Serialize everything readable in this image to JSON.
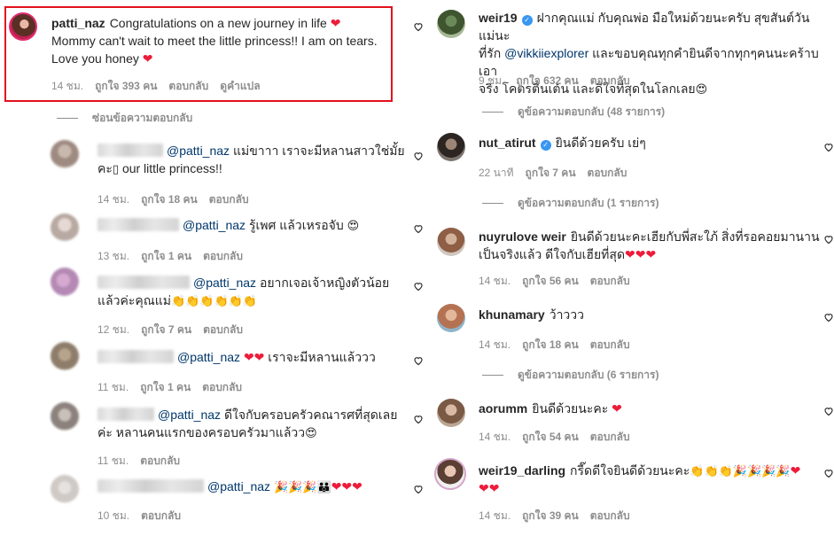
{
  "colors": {
    "highlight": "#e2111c",
    "verified": "#3897f0",
    "mention": "#00376b",
    "meta": "#8e8e8e",
    "heart": "#ed1c3a"
  },
  "icons": {
    "like": "heart-outline-icon",
    "verified": "verified-badge-icon"
  },
  "left": {
    "top_comment": {
      "username": "patti_naz",
      "text_1": "Congratulations on a new journey in life",
      "text_2": "Mommy can't wait to meet the little princess!! I am on tears.",
      "text_3": "Love you honey",
      "time": "14 ชม.",
      "likes": "ถูกใจ 393 คน",
      "reply": "ตอบกลับ",
      "translate": "ดูคำแปล"
    },
    "hide_replies": "ซ่อนข้อความตอบกลับ",
    "replies": [
      {
        "mention": "@patti_naz",
        "text_1": "แม่ขาาา เราจะมีหลานสาวใช่มั้ย",
        "text_2": "คะ",
        "text_3": "our little princess!!",
        "time": "14 ชม.",
        "likes": "ถูกใจ 18 คน",
        "reply": "ตอบกลับ"
      },
      {
        "mention": "@patti_naz",
        "text_1": "รู้เพศ แล้วเหรอจับ",
        "time": "13 ชม.",
        "likes": "ถูกใจ 1 คน",
        "reply": "ตอบกลับ"
      },
      {
        "mention": "@patti_naz",
        "text_1": "อยากเจอเจ้าหญิงตัวน้อย",
        "text_2": "แล้วค่ะคุณแม่",
        "time": "12 ชม.",
        "likes": "ถูกใจ 7 คน",
        "reply": "ตอบกลับ"
      },
      {
        "mention": "@patti_naz",
        "text_1": "เราจะมีหลานแล้ววว",
        "time": "11 ชม.",
        "likes": "ถูกใจ 1 คน",
        "reply": "ตอบกลับ"
      },
      {
        "mention": "@patti_naz",
        "text_1": "ดีใจกับครอบครัวคณารศที่สุดเลย",
        "text_2": "ค่ะ หลานคนแรกของครอบครัวมาแล้วว",
        "time": "11 ชม.",
        "reply": "ตอบกลับ"
      },
      {
        "mention": "@patti_naz",
        "time": "10 ชม.",
        "reply": "ตอบกลับ"
      }
    ]
  },
  "right": {
    "comments": [
      {
        "username": "weir19",
        "text_1": "ฝากคุณแม่ กับคุณพ่อ มือใหม่ด้วยนะครับ สุขสันต์วันแม่นะ",
        "text_2": "ที่รัก",
        "mention": "@vikkiiexplorer",
        "text_3": "และขอบคุณทุกคำยินดีจากทุกๆคนนะคร้าบ เอา",
        "text_4": "จริง โคตรตื่นเต้น และดีใจที่สุดในโลกเลย",
        "time": "9 ชม.",
        "likes": "ถูกใจ 632 คน",
        "reply": "ตอบกลับ",
        "view_replies": "ดูข้อความตอบกลับ (48 รายการ)"
      },
      {
        "username": "nut_atirut",
        "text_1": "ยินดีด้วยครับ เย่ๆ",
        "time": "22 นาที",
        "likes": "ถูกใจ 7 คน",
        "reply": "ตอบกลับ",
        "view_replies": "ดูข้อความตอบกลับ (1 รายการ)"
      },
      {
        "username": "nuyrulove weir",
        "text_1": "ยินดีด้วยนะคะเฮียกับพี่สะใภ้ สิ่งที่รอคอยมานาน",
        "text_2": "เป็นจริงแล้ว ดีใจกับเฮียที่สุด",
        "time": "14 ชม.",
        "likes": "ถูกใจ 56 คน",
        "reply": "ตอบกลับ"
      },
      {
        "username": "khunamary",
        "text_1": "ว้าววว",
        "time": "14 ชม.",
        "likes": "ถูกใจ 18 คน",
        "reply": "ตอบกลับ",
        "view_replies": "ดูข้อความตอบกลับ (6 รายการ)"
      },
      {
        "username": "aorumm",
        "text_1": "ยินดีด้วยนะคะ",
        "time": "14 ชม.",
        "likes": "ถูกใจ 54 คน",
        "reply": "ตอบกลับ"
      },
      {
        "username": "weir19_darling",
        "text_1": "กรี๊ดดีใจยินดีด้วยนะคะ",
        "time": "14 ชม.",
        "likes": "ถูกใจ 39 คน",
        "reply": "ตอบกลับ"
      }
    ]
  }
}
